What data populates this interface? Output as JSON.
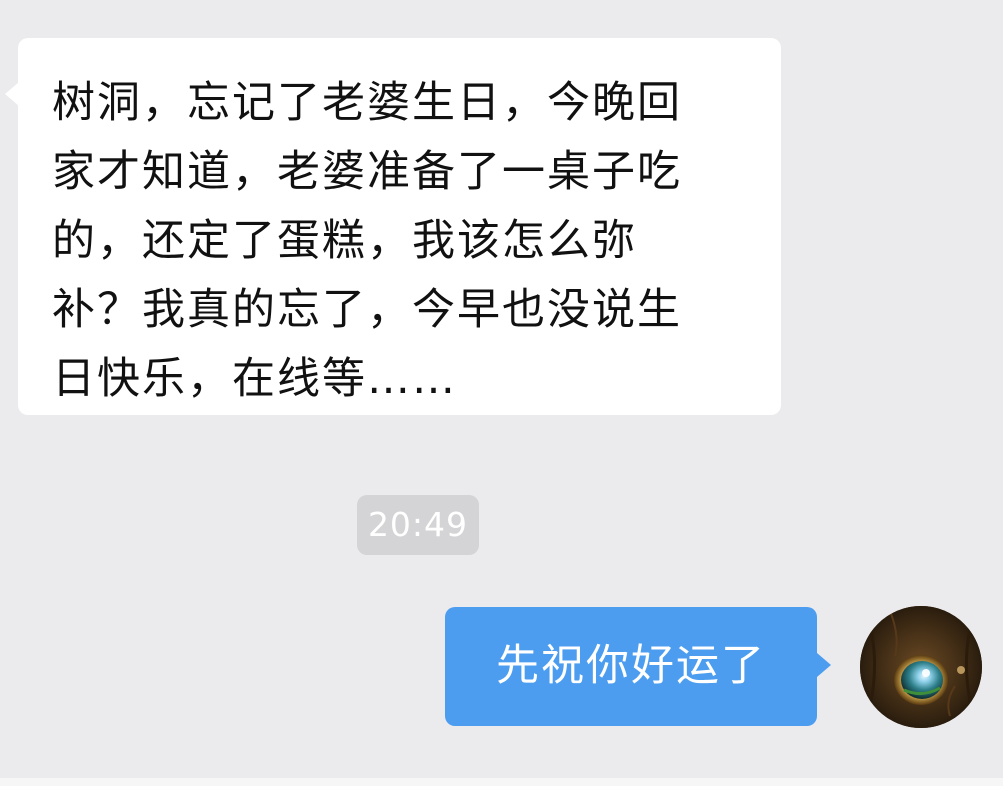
{
  "conversation": {
    "incoming_message": {
      "lines": [
        "树洞，忘记了老婆生日，今晚回",
        "家才知道，老婆准备了一桌子吃",
        "的，还定了蛋糕，我该怎么弥",
        "补？我真的忘了，今早也没说生",
        "日快乐，在线等……"
      ]
    },
    "timestamp": "20:49",
    "outgoing_message": {
      "text": "先祝你好运了"
    },
    "avatar_icon": "tree-hollow-avatar-icon"
  },
  "colors": {
    "chat_background": "#ebebed",
    "incoming_bubble": "#ffffff",
    "outgoing_bubble": "#4c9df0",
    "timestamp_pill": "#d4d4d6"
  }
}
